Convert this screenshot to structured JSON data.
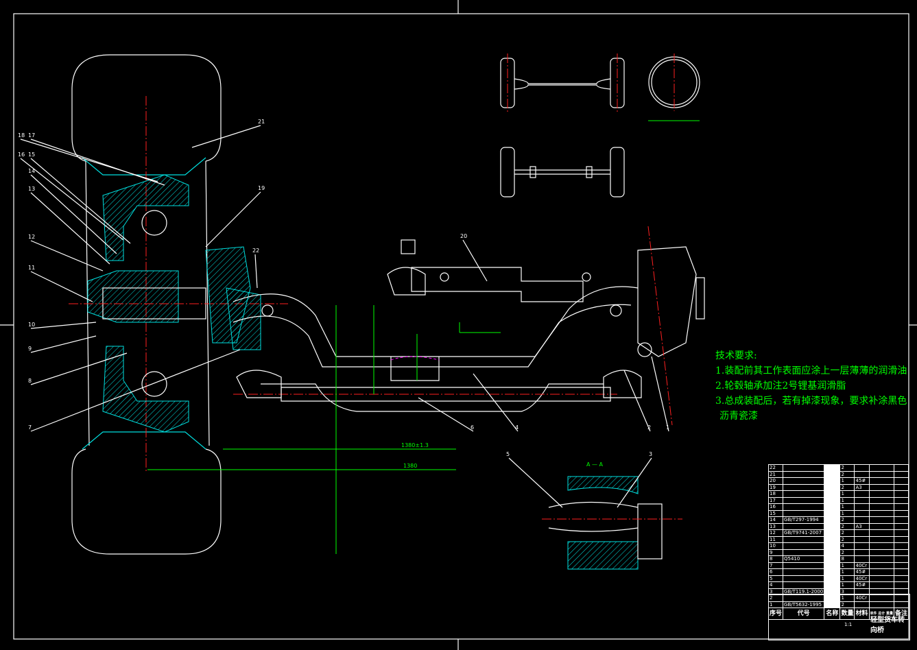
{
  "tech_requirements": {
    "heading": "技术要求:",
    "items": [
      "1.装配前其工作表面应涂上一层薄薄的润滑油",
      "2.轮毂轴承加注2号锂基润滑脂",
      "3.总成装配后，若有掉漆现象，要求补涂黑色",
      "沥青瓷漆"
    ]
  },
  "drawing": {
    "part_labels": [
      "1",
      "2",
      "3",
      "4",
      "5",
      "6",
      "7",
      "8",
      "9",
      "10",
      "11",
      "12",
      "13",
      "14",
      "15",
      "16",
      "17",
      "18",
      "19",
      "20",
      "21",
      "22"
    ],
    "section_label": "A — A",
    "dimensions": [
      "1380±1.3",
      "1380"
    ]
  },
  "parts_list": {
    "headers": [
      "序号",
      "代号",
      "名称",
      "数量",
      "材料",
      "单件 总计 重量",
      "备注"
    ],
    "rows": [
      {
        "no": "22",
        "code": "",
        "qty": "2",
        "material": ""
      },
      {
        "no": "21",
        "code": "",
        "qty": "2",
        "material": ""
      },
      {
        "no": "20",
        "code": "",
        "qty": "1",
        "material": "45#"
      },
      {
        "no": "19",
        "code": "",
        "qty": "2",
        "material": "A3"
      },
      {
        "no": "18",
        "code": "",
        "qty": "1",
        "material": ""
      },
      {
        "no": "17",
        "code": "",
        "qty": "1",
        "material": ""
      },
      {
        "no": "16",
        "code": "",
        "qty": "1",
        "material": ""
      },
      {
        "no": "15",
        "code": "",
        "qty": "1",
        "material": ""
      },
      {
        "no": "14",
        "code": "GB/T297-1994",
        "qty": "2",
        "material": ""
      },
      {
        "no": "13",
        "code": "",
        "qty": "2",
        "material": "A3"
      },
      {
        "no": "12",
        "code": "GB/T9741-2007",
        "qty": "2",
        "material": ""
      },
      {
        "no": "11",
        "code": "",
        "qty": "2",
        "material": ""
      },
      {
        "no": "10",
        "code": "",
        "qty": "4",
        "material": ""
      },
      {
        "no": "9",
        "code": "",
        "qty": "2",
        "material": ""
      },
      {
        "no": "8",
        "code": "Q5410",
        "qty": "8",
        "material": ""
      },
      {
        "no": "7",
        "code": "",
        "qty": "1",
        "material": "40Cr"
      },
      {
        "no": "6",
        "code": "",
        "qty": "1",
        "material": "45#"
      },
      {
        "no": "5",
        "code": "",
        "qty": "1",
        "material": "40Cr"
      },
      {
        "no": "4",
        "code": "",
        "qty": "1",
        "material": "45#"
      },
      {
        "no": "3",
        "code": "GB/T119.1-2000",
        "qty": "3",
        "material": ""
      },
      {
        "no": "2",
        "code": "",
        "qty": "1",
        "material": "40Cr"
      },
      {
        "no": "1",
        "code": "GB/T5632-1995",
        "qty": "2",
        "material": ""
      }
    ]
  },
  "title_block": {
    "drawing_title": "轻型货车转向桥",
    "scale": "1:1"
  },
  "colors": {
    "background": "#000000",
    "outline": "#ffffff",
    "section": "#00e0e0",
    "centerline": "#ff2020",
    "dimension": "#00ff00"
  }
}
